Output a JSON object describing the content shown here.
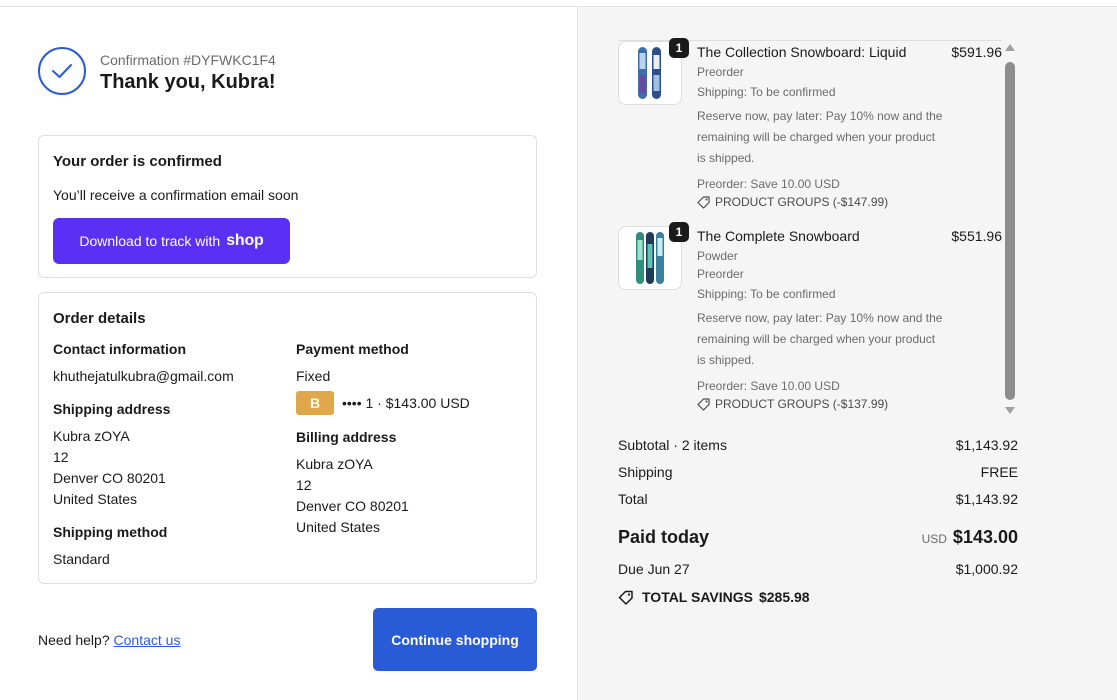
{
  "confirmation": {
    "number": "Confirmation #DYFWKC1F4",
    "thanks": "Thank you, Kubra!"
  },
  "order_confirmed": {
    "heading": "Your order is confirmed",
    "message": "You’ll receive a confirmation email soon",
    "shop_button_prefix": "Download to track with",
    "shop_button_logo": "shop"
  },
  "order_details": {
    "heading": "Order details",
    "contact_label": "Contact information",
    "contact_email": "khuthejatulkubra@gmail.com",
    "payment_label": "Payment method",
    "payment_type": "Fixed",
    "payment_badge": "B",
    "payment_summary": "•••• 1 · $143.00 USD",
    "shipping_address_label": "Shipping address",
    "shipping_address": [
      "Kubra zOYA",
      "12",
      "Denver CO 80201",
      "United States"
    ],
    "billing_address_label": "Billing address",
    "billing_address": [
      "Kubra zOYA",
      "12",
      "Denver CO 80201",
      "United States"
    ],
    "shipping_method_label": "Shipping method",
    "shipping_method": "Standard"
  },
  "footer": {
    "help_text": "Need help?",
    "contact_link": "Contact us",
    "continue_button": "Continue shopping"
  },
  "items": [
    {
      "qty": "1",
      "title": "The Collection Snowboard: Liquid",
      "price": "$591.96",
      "variant": "",
      "preorder": "Preorder",
      "shipping": "Shipping: To be confirmed",
      "description": "Reserve now, pay later: Pay 10% now and the remaining will be charged when your product is shipped.",
      "saving": "Preorder: Save 10.00 USD",
      "discount": "PRODUCT GROUPS (-$147.99)"
    },
    {
      "qty": "1",
      "title": "The Complete Snowboard",
      "price": "$551.96",
      "variant": "Powder",
      "preorder": "Preorder",
      "shipping": "Shipping: To be confirmed",
      "description": "Reserve now, pay later: Pay 10% now and the remaining will be charged when your product is shipped.",
      "saving": "Preorder: Save 10.00 USD",
      "discount": "PRODUCT GROUPS (-$137.99)"
    }
  ],
  "summary": {
    "subtotal_label": "Subtotal · 2 items",
    "subtotal_value": "$1,143.92",
    "shipping_label": "Shipping",
    "shipping_value": "FREE",
    "total_label": "Total",
    "total_value": "$1,143.92",
    "paid_label": "Paid today",
    "paid_currency": "USD",
    "paid_value": "$143.00",
    "due_label": "Due Jun 27",
    "due_value": "$1,000.92",
    "savings_label": "TOTAL SAVINGS",
    "savings_value": "$285.98"
  },
  "colors": {
    "primary": "#2a5bd7",
    "shop_purple": "#5a31f4",
    "badge_gold": "#e0a84a"
  }
}
